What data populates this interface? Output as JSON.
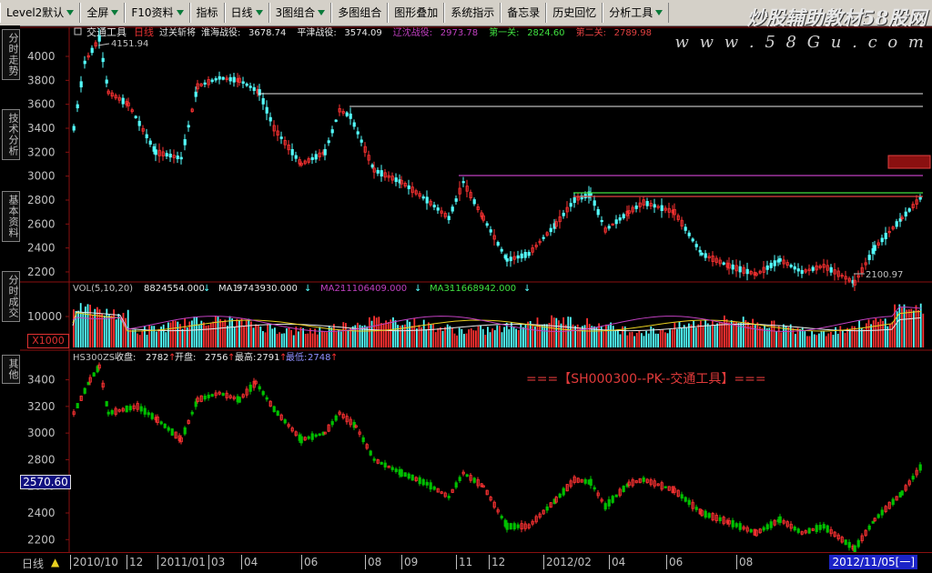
{
  "toolbar": {
    "items": [
      {
        "label": "Level2默认",
        "arrow": true
      },
      {
        "label": "全屏",
        "arrow": true
      },
      {
        "label": "F10资料",
        "arrow": true
      },
      {
        "label": "指标",
        "arrow": false
      },
      {
        "label": "日线",
        "arrow": true
      },
      {
        "label": "3图组合",
        "arrow": true
      },
      {
        "label": "多图组合",
        "arrow": false
      },
      {
        "label": "图形叠加",
        "arrow": false
      },
      {
        "label": "系统指示",
        "arrow": false
      },
      {
        "label": "备忘录",
        "arrow": false
      },
      {
        "label": "历史回忆",
        "arrow": false
      },
      {
        "label": "分析工具",
        "arrow": true
      }
    ]
  },
  "watermark": {
    "line1": "炒股辅助教材58股网",
    "line2": "w w w . 5 8 G u . c o m"
  },
  "sidebar": {
    "tabs": [
      "分时走势",
      "技术分析",
      "基本资料",
      "分时成交",
      "其他"
    ]
  },
  "main_panel": {
    "indicator_name": "交通工具",
    "period": "日线",
    "legend": [
      {
        "label": "过关斩将",
        "value": ""
      },
      {
        "label": "淮海战役:",
        "value": "3678.74",
        "color": "#e8e8e8"
      },
      {
        "label": "平津战役:",
        "value": "3574.09",
        "color": "#e8e8e8"
      },
      {
        "label": "辽沈战役:",
        "value": "2973.78",
        "color": "#c040c0"
      },
      {
        "label": "第一关:",
        "value": "2824.60",
        "color": "#40e040"
      },
      {
        "label": "第二关:",
        "value": "2789.98",
        "color": "#e04040"
      }
    ],
    "high_label": "4151.94",
    "low_label": "2100.97",
    "y_ticks": [
      "4000",
      "3800",
      "3600",
      "3400",
      "3200",
      "3000",
      "2800",
      "2600",
      "2400",
      "2200"
    ]
  },
  "volume_panel": {
    "header": "VOL(5,10,20)",
    "vol": "8824554.000",
    "ma1_label": "MA1:",
    "ma1": "9743930.000",
    "ma2_label": "MA2:",
    "ma2": "11106409.000",
    "ma3_label": "MA3:",
    "ma3": "11668942.000",
    "y_tick": "10000",
    "zoom": "X1000"
  },
  "overlay_panel": {
    "symbol": "HS300ZS",
    "close_label": "收盘:",
    "close": "2782",
    "open_label": "开盘:",
    "open": "2756",
    "high_label": "最高:",
    "high": "2791",
    "low_label": "最低:",
    "low": "2748",
    "y_ticks": [
      "3400",
      "3200",
      "3000",
      "2800",
      "2600",
      "2400",
      "2200"
    ],
    "current_value": "2570.60",
    "annotation": "===【SH000300--PK--交通工具】==="
  },
  "status_bar": {
    "period": "日线",
    "dates": [
      "2010/10",
      "12",
      "2011/01",
      "03",
      "04",
      "06",
      "08",
      "09",
      "11",
      "12",
      "2012/02",
      "04",
      "06",
      "08"
    ],
    "current_date": "2012/11/05[一]"
  },
  "colors": {
    "up": "#ff3232",
    "down": "#54ffff",
    "overlay_up": "#ff3232",
    "overlay_down": "#00c000",
    "grid": "#8a1010",
    "accent": "#1c24c8"
  }
}
